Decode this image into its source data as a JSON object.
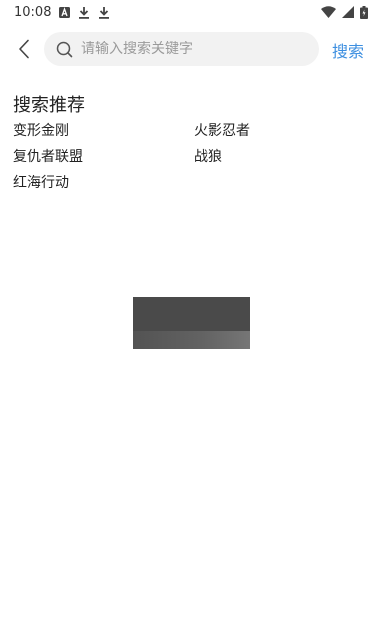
{
  "status_bar": {
    "time": "10:08",
    "left_icons": [
      "a-letter-icon",
      "download-icon",
      "download-icon"
    ],
    "right_icons": [
      "wifi-icon",
      "signal-icon",
      "battery-icon"
    ]
  },
  "search": {
    "placeholder": "请输入搜索关键字",
    "value": "",
    "submit_label": "搜索",
    "accent_color": "#3d8fe0"
  },
  "recommendations": {
    "title": "搜索推荐",
    "items": [
      {
        "label": "变形金刚"
      },
      {
        "label": "火影忍者"
      },
      {
        "label": "复仇者联盟"
      },
      {
        "label": "战狼"
      },
      {
        "label": "红海行动"
      }
    ]
  }
}
